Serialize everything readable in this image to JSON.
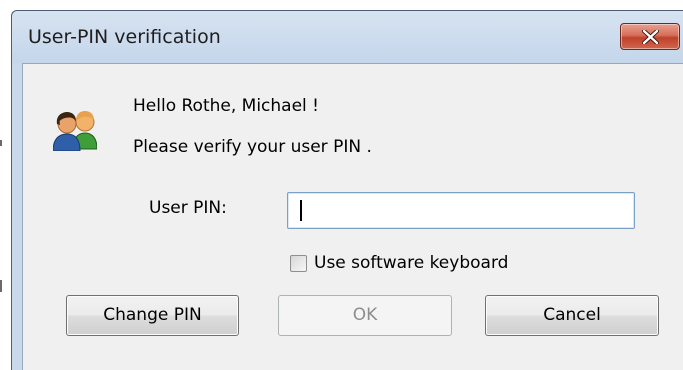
{
  "dialog": {
    "title": "User-PIN verification",
    "greeting": "Hello Rothe, Michael !",
    "instruction": "Please verify your user PIN .",
    "pin_label": "User PIN:",
    "pin_value": "",
    "checkbox_label": "Use software keyboard",
    "checkbox_checked": false,
    "buttons": {
      "change_pin": "Change PIN",
      "ok": "OK",
      "cancel": "Cancel"
    },
    "ok_enabled": false
  },
  "icons": {
    "close": "close-icon",
    "users": "users-icon"
  },
  "colors": {
    "title_bar": "#c7d8ec",
    "client_bg": "#f0f0f0",
    "close_button": "#c7432d",
    "input_border": "#7aa0c8"
  }
}
